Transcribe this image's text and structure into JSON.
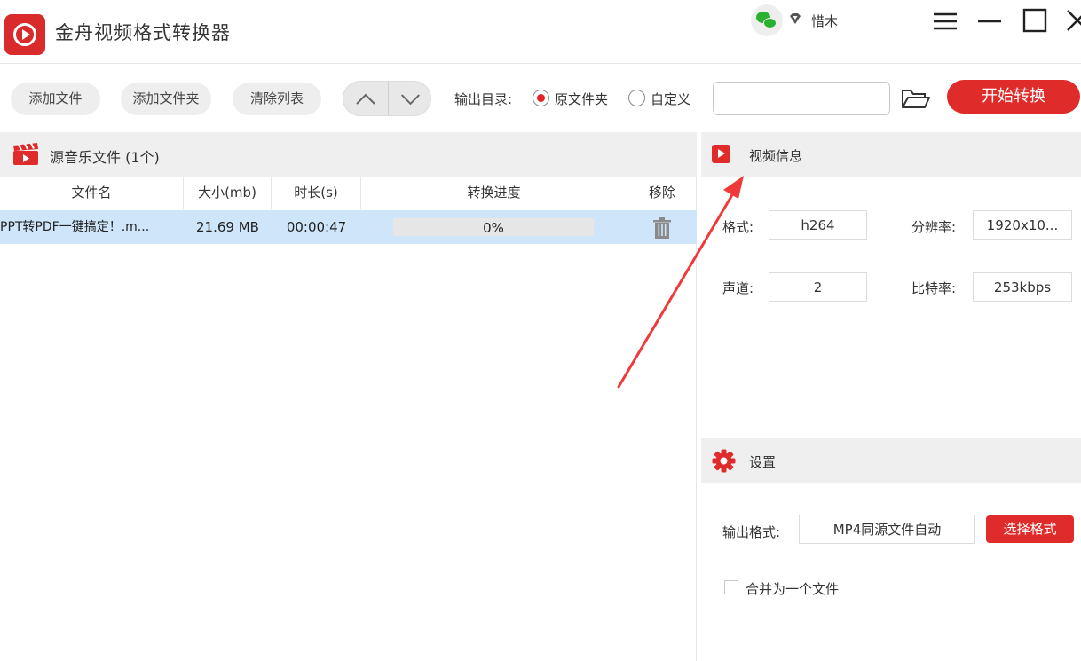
{
  "app": {
    "title": "金舟视频格式转换器",
    "user_name": "惜木"
  },
  "toolbar": {
    "add_file": "添加文件",
    "add_folder": "添加文件夹",
    "clear_list": "清除列表",
    "output_dir_label": "输出目录:",
    "radio_original": "原文件夹",
    "radio_custom": "自定义",
    "selected_output": "原文件夹",
    "path_value": "",
    "start_button": "开始转换"
  },
  "file_list": {
    "title": "源音乐文件 (1个)",
    "columns": [
      "文件名",
      "大小(mb)",
      "时长(s)",
      "转换进度",
      "移除"
    ],
    "rows": [
      {
        "name": "PPT转PDF一键搞定！.m...",
        "size": "21.69 MB",
        "duration": "00:00:47",
        "progress_text": "0%",
        "progress": 0
      }
    ]
  },
  "video_info": {
    "title": "视频信息",
    "format_label": "格式:",
    "format_value": "h264",
    "resolution_label": "分辨率:",
    "resolution_value": "1920x10...",
    "channels_label": "声道:",
    "channels_value": "2",
    "bitrate_label": "比特率:",
    "bitrate_value": "253kbps"
  },
  "settings": {
    "title": "设置",
    "output_format_label": "输出格式:",
    "output_format_value": "MP4同源文件自动",
    "choose_format": "选择格式",
    "merge_label": "合并为一个文件",
    "merge_checked": false
  },
  "colors": {
    "accent": "#e02b2b",
    "selected_row": "#cfe6fa",
    "wechat_green": "#29b12f"
  },
  "icons": [
    "app-logo-icon",
    "wechat-icon",
    "diamond-icon",
    "menu-icon",
    "minimize-icon",
    "maximize-icon",
    "close-icon",
    "chevron-up-icon",
    "chevron-down-icon",
    "folder-open-icon",
    "clapperboard-icon",
    "trash-icon",
    "play-icon",
    "gear-icon",
    "annotation-arrow"
  ]
}
